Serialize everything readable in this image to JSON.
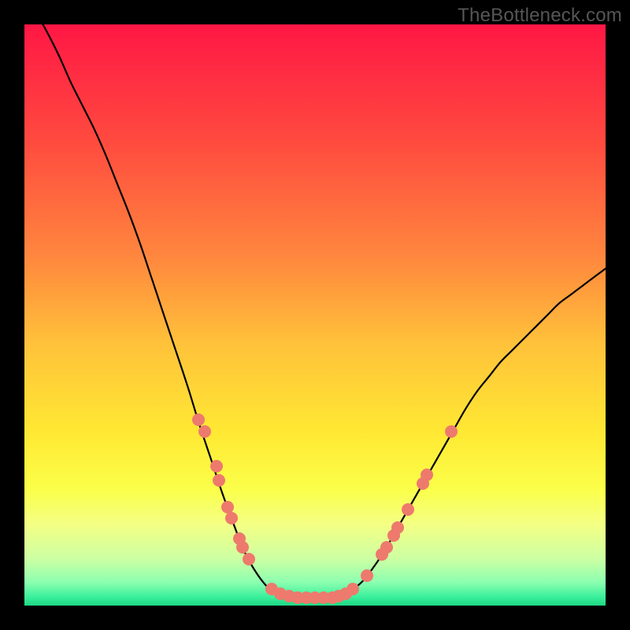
{
  "watermark": "TheBottleneck.com",
  "chart_data": {
    "type": "line",
    "title": "",
    "xlabel": "",
    "ylabel": "",
    "xlim": [
      0,
      100
    ],
    "ylim": [
      0,
      100
    ],
    "background": {
      "type": "vertical-gradient",
      "stops": [
        {
          "pos": 0.0,
          "color": "#ff1745"
        },
        {
          "pos": 0.2,
          "color": "#ff4a3f"
        },
        {
          "pos": 0.4,
          "color": "#ff873e"
        },
        {
          "pos": 0.55,
          "color": "#ffc23a"
        },
        {
          "pos": 0.7,
          "color": "#ffe833"
        },
        {
          "pos": 0.8,
          "color": "#fbff49"
        },
        {
          "pos": 0.86,
          "color": "#f4ff84"
        },
        {
          "pos": 0.92,
          "color": "#ccffa3"
        },
        {
          "pos": 0.96,
          "color": "#8cffb0"
        },
        {
          "pos": 0.985,
          "color": "#3af09b"
        },
        {
          "pos": 1.0,
          "color": "#1ed784"
        }
      ]
    },
    "series": [
      {
        "name": "bottleneck-curve",
        "x": [
          0,
          2,
          4,
          6,
          8,
          10,
          12,
          14,
          16,
          18,
          20,
          22,
          24,
          26,
          28,
          30,
          32,
          34,
          36,
          38,
          40,
          42,
          44,
          46,
          48,
          50,
          52,
          54,
          56,
          58,
          60,
          62,
          64,
          66,
          68,
          70,
          72,
          74,
          76,
          78,
          80,
          82,
          84,
          86,
          88,
          90,
          92,
          94,
          96,
          98,
          100
        ],
        "y": [
          105,
          102,
          98.5,
          94.5,
          90,
          86,
          82,
          77.5,
          72.5,
          67.5,
          62,
          56,
          50,
          44,
          38,
          31.5,
          25.5,
          19.5,
          14,
          9,
          5.5,
          3,
          1.5,
          1,
          1,
          1,
          1,
          1.5,
          2.5,
          4,
          6.5,
          9.5,
          13,
          16.5,
          20,
          23.5,
          27,
          30.5,
          34,
          37,
          39.5,
          42,
          44,
          46,
          48,
          50,
          52,
          53.5,
          55,
          56.5,
          58
        ]
      }
    ],
    "markers": [
      {
        "x": 30.0,
        "y": 32.0
      },
      {
        "x": 31.0,
        "y": 30.0
      },
      {
        "x": 33.0,
        "y": 24.0
      },
      {
        "x": 33.5,
        "y": 21.5
      },
      {
        "x": 35.0,
        "y": 17.0
      },
      {
        "x": 35.6,
        "y": 15.0
      },
      {
        "x": 37.0,
        "y": 11.5
      },
      {
        "x": 37.6,
        "y": 10.0
      },
      {
        "x": 38.6,
        "y": 8.0
      },
      {
        "x": 42.5,
        "y": 2.8
      },
      {
        "x": 44.0,
        "y": 2.0
      },
      {
        "x": 45.5,
        "y": 1.6
      },
      {
        "x": 47.0,
        "y": 1.4
      },
      {
        "x": 48.5,
        "y": 1.3
      },
      {
        "x": 50.0,
        "y": 1.3
      },
      {
        "x": 51.5,
        "y": 1.3
      },
      {
        "x": 53.0,
        "y": 1.4
      },
      {
        "x": 54.0,
        "y": 1.6
      },
      {
        "x": 55.3,
        "y": 2.0
      },
      {
        "x": 56.5,
        "y": 2.8
      },
      {
        "x": 59.0,
        "y": 5.2
      },
      {
        "x": 61.5,
        "y": 8.8
      },
      {
        "x": 62.3,
        "y": 10.0
      },
      {
        "x": 63.5,
        "y": 12.0
      },
      {
        "x": 64.2,
        "y": 13.4
      },
      {
        "x": 66.0,
        "y": 16.5
      },
      {
        "x": 68.5,
        "y": 21.0
      },
      {
        "x": 69.3,
        "y": 22.5
      },
      {
        "x": 73.5,
        "y": 30.0
      }
    ]
  }
}
